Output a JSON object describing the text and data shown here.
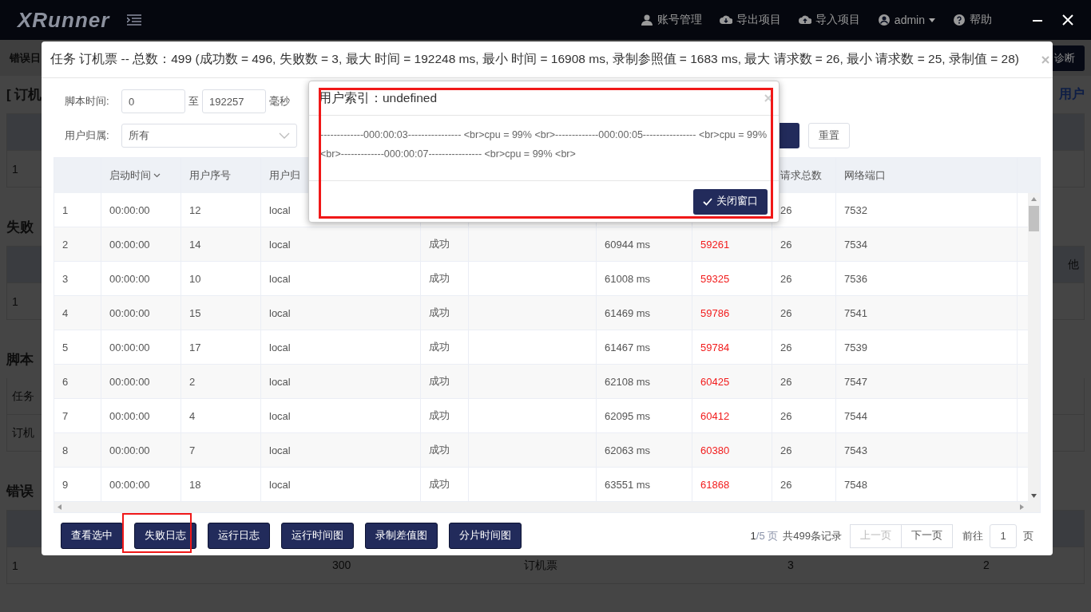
{
  "top_bar": {
    "logo": "XRunner",
    "menu": [
      {
        "label": "账号管理"
      },
      {
        "label": "导出项目"
      },
      {
        "label": "导入项目"
      },
      {
        "label": "admin",
        "dropdown": true
      },
      {
        "label": "帮助"
      }
    ]
  },
  "background": {
    "toolbar_title": "错误日",
    "diagnose_button": "诊断",
    "sections": [
      {
        "title": "[ 订机",
        "right_text": "用户",
        "rows": [
          {
            "kind": "header"
          },
          {
            "kind": "row",
            "text": "1"
          }
        ]
      },
      {
        "title": "失败",
        "rows": [
          {
            "kind": "header",
            "right_text": "他"
          },
          {
            "kind": "row",
            "text": "1"
          }
        ]
      },
      {
        "title": "脚本",
        "rows": [
          {
            "kind": "row",
            "text": "任务"
          },
          {
            "kind": "row",
            "text": "订机"
          }
        ]
      },
      {
        "title": "错误",
        "rows": [
          {
            "kind": "header"
          },
          {
            "kind": "row",
            "text": "1",
            "cells": [
              "300",
              "订机票",
              "3",
              "2"
            ]
          }
        ]
      }
    ]
  },
  "dialog": {
    "title": "任务 订机票 -- 总数：499 (成功数 = 496, 失败数 = 3, 最大 时间 = 192248 ms, 最小 时间 = 16908 ms, 录制参照值 = 1683 ms, 最大 请求数 = 26, 最小 请求数 = 25, 录制值 = 28)",
    "filters": {
      "time_label": "脚本时间:",
      "time_from": "0",
      "to_label": "至",
      "time_to": "192257",
      "unit": "毫秒",
      "owner_label": "用户归属:",
      "owner_value": "所有",
      "reset_button": "重置"
    },
    "table": {
      "columns": [
        {
          "label": "启动时间",
          "sortable": true
        },
        {
          "label": "用户序号"
        },
        {
          "label": "用户归"
        },
        {},
        {},
        {},
        {},
        {
          "label": "请求总数"
        },
        {
          "label": "网络端口"
        }
      ],
      "rows": [
        {
          "index": "1",
          "start": "00:00:00",
          "user_no": "12",
          "owner": "local",
          "requests": "26",
          "port": "7532"
        },
        {
          "index": "2",
          "start": "00:00:00",
          "user_no": "14",
          "owner": "local",
          "status": "成功",
          "time": "60944 ms",
          "diff": "59261",
          "requests": "26",
          "port": "7534"
        },
        {
          "index": "3",
          "start": "00:00:00",
          "user_no": "10",
          "owner": "local",
          "status": "成功",
          "time": "61008 ms",
          "diff": "59325",
          "requests": "26",
          "port": "7536"
        },
        {
          "index": "4",
          "start": "00:00:00",
          "user_no": "15",
          "owner": "local",
          "status": "成功",
          "time": "61469 ms",
          "diff": "59786",
          "requests": "26",
          "port": "7541"
        },
        {
          "index": "5",
          "start": "00:00:00",
          "user_no": "17",
          "owner": "local",
          "status": "成功",
          "time": "61467 ms",
          "diff": "59784",
          "requests": "26",
          "port": "7539"
        },
        {
          "index": "6",
          "start": "00:00:00",
          "user_no": "2",
          "owner": "local",
          "status": "成功",
          "time": "62108 ms",
          "diff": "60425",
          "requests": "26",
          "port": "7547"
        },
        {
          "index": "7",
          "start": "00:00:00",
          "user_no": "4",
          "owner": "local",
          "status": "成功",
          "time": "62095 ms",
          "diff": "60412",
          "requests": "26",
          "port": "7544"
        },
        {
          "index": "8",
          "start": "00:00:00",
          "user_no": "7",
          "owner": "local",
          "status": "成功",
          "time": "62063 ms",
          "diff": "60380",
          "requests": "26",
          "port": "7543"
        },
        {
          "index": "9",
          "start": "00:00:00",
          "user_no": "18",
          "owner": "local",
          "status": "成功",
          "time": "63551 ms",
          "diff": "61868",
          "requests": "26",
          "port": "7548"
        }
      ]
    },
    "actions": [
      {
        "label": "查看选中",
        "highlighted": false
      },
      {
        "label": "失败日志",
        "highlighted": true
      },
      {
        "label": "运行日志",
        "highlighted": false
      },
      {
        "label": "运行时间图",
        "highlighted": false
      },
      {
        "label": "录制差值图",
        "highlighted": false
      },
      {
        "label": "分片时间图",
        "highlighted": false
      }
    ],
    "pagination": {
      "current": "1",
      "total": "/5 页",
      "count": "共499条记录",
      "prev": {
        "label": "上一页",
        "disabled": true
      },
      "next": {
        "label": "下一页",
        "disabled": false
      },
      "goto_label": "前往",
      "goto_value": "1",
      "page_unit": "页"
    }
  },
  "popup": {
    "title": "用户索引：undefined",
    "body": "-------------000:00:03---------------- <br>cpu = 99% <br>-------------000:00:05---------------- <br>cpu = 99% <br>-------------000:00:07---------------- <br>cpu = 99% <br>",
    "close_button": "关闭窗口",
    "highlighted": true
  }
}
